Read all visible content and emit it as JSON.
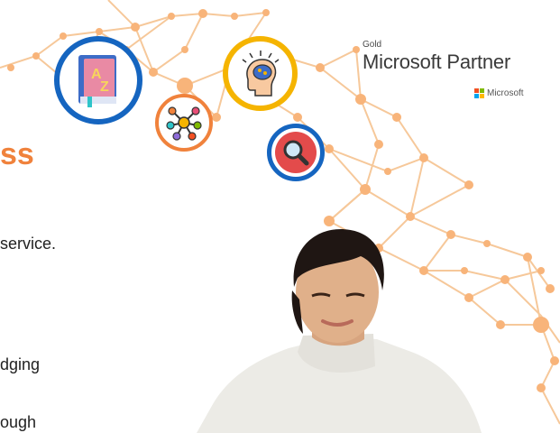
{
  "partner": {
    "gold": "Gold",
    "title": "Microsoft Partner",
    "microsoft": "Microsoft"
  },
  "heading": "ss",
  "lines": [
    " service.",
    "dging",
    "ough"
  ],
  "icons": [
    "dictionary-icon",
    "network-icon",
    "brain-icon",
    "magnifier-icon"
  ],
  "colors": {
    "accent_orange": "#f0823c",
    "accent_blue": "#1565c0",
    "accent_yellow": "#f5b400",
    "network_lines": "#f6c89a"
  }
}
